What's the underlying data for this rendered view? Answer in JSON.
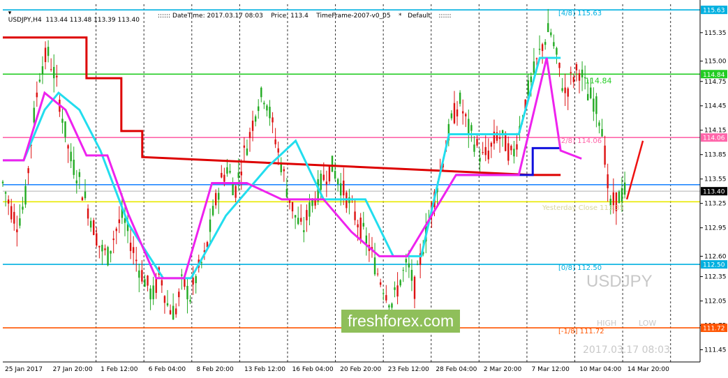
{
  "header": {
    "symbol_line": "USDJPY,H4  113.44 113.48 113.39 113.40",
    "info_line": ":::::: DateTime: 2017.03.17 08:03    Price: 113.4    TimeFrame-2007-v0_05    *   Default    ::::::"
  },
  "watermark": "freshforex.com",
  "overlay": {
    "symbol": "USDJPY",
    "high_label": "HIGH",
    "low_label": "LOW",
    "datetime": "2017.03.17 08:03",
    "yesterday_close": "Yesterday Close 113.35"
  },
  "chart_data": {
    "type": "candlestick",
    "ylim": [
      111.3,
      115.7
    ],
    "x_ticks": [
      "25 Jan 2017",
      "27 Jan 20:00",
      "1 Feb 12:00",
      "6 Feb 04:00",
      "8 Feb 20:00",
      "13 Feb 12:00",
      "16 Feb 04:00",
      "20 Feb 20:00",
      "23 Feb 12:00",
      "28 Feb 04:00",
      "2 Mar 20:00",
      "7 Mar 12:00",
      "10 Mar 04:00",
      "14 Mar 20:00"
    ],
    "y_ticks": [
      "115.35",
      "115.00",
      "114.75",
      "114.45",
      "114.15",
      "113.85",
      "113.55",
      "113.25",
      "112.95",
      "112.60",
      "112.35",
      "112.05",
      "111.75",
      "111.45"
    ],
    "murrey_levels": [
      {
        "label": "[4/8]",
        "value": 115.63,
        "price": "115.63",
        "color": "#00b0e0"
      },
      {
        "label": "",
        "value": 114.84,
        "price": "114.84",
        "color": "#22cc22"
      },
      {
        "label": "[2/8]",
        "value": 114.06,
        "price": "114.06",
        "color": "#ff66aa"
      },
      {
        "label": "",
        "value": 113.48,
        "price": "",
        "color": "#2288ff"
      },
      {
        "label": "",
        "value": 113.27,
        "price": "",
        "color": "#e8e800"
      },
      {
        "label": "[0/8]",
        "value": 112.5,
        "price": "112.50",
        "color": "#00b0e0"
      },
      {
        "label": "[-1/8]",
        "value": 111.72,
        "price": "111.72",
        "color": "#ff5500"
      }
    ],
    "current_price": {
      "value": 113.4,
      "price": "113.40"
    },
    "level_texts": {
      "green": "114.84",
      "pink": "114.06",
      "blue": "112.50",
      "orange": "111.72",
      "yc": "113.35"
    },
    "ohlc_closes": [
      113.5,
      113.2,
      113.0,
      113.3,
      114.2,
      114.9,
      115.1,
      114.8,
      114.3,
      113.8,
      113.6,
      113.3,
      113.0,
      112.7,
      112.6,
      112.9,
      113.1,
      112.8,
      112.5,
      112.3,
      112.1,
      112.4,
      112.0,
      111.9,
      112.3,
      112.1,
      112.4,
      112.6,
      113.1,
      113.5,
      113.7,
      113.4,
      113.8,
      114.1,
      114.5,
      114.6,
      114.2,
      113.8,
      113.4,
      113.1,
      112.9,
      113.2,
      113.4,
      113.6,
      113.7,
      113.5,
      113.3,
      113.1,
      112.9,
      112.7,
      112.4,
      112.2,
      112.0,
      112.3,
      112.5,
      112.2,
      112.7,
      113.1,
      113.5,
      113.9,
      114.3,
      114.5,
      114.2,
      114.0,
      113.8,
      113.9,
      114.1,
      114.0,
      113.8,
      114.2,
      114.6,
      114.9,
      115.2,
      115.4,
      115.0,
      114.6,
      114.8,
      114.9,
      114.6,
      114.5,
      114.2,
      113.2,
      113.3,
      113.4
    ],
    "trend_red": {
      "x": [
        0,
        0.12,
        0.12,
        0.15,
        0.15,
        0.17,
        0.17,
        0.2,
        0.2,
        0.76,
        0.76,
        0.8
      ],
      "y": [
        115.29,
        115.29,
        114.79,
        114.79,
        114.79,
        114.79,
        114.14,
        114.14,
        113.82,
        113.6,
        113.6,
        113.6
      ]
    },
    "trend_blue": {
      "x": [
        0.65,
        0.76,
        0.76,
        0.8
      ],
      "y": [
        113.6,
        113.6,
        113.93,
        113.93
      ]
    },
    "trend_cyan": {
      "x": [
        0,
        0.03,
        0.06,
        0.08,
        0.11,
        0.14,
        0.18,
        0.23,
        0.27,
        0.32,
        0.38,
        0.42,
        0.46,
        0.52,
        0.56,
        0.6,
        0.64,
        0.7,
        0.74,
        0.77,
        0.8
      ],
      "y": [
        113.78,
        113.78,
        114.4,
        114.61,
        114.4,
        113.9,
        113.0,
        112.33,
        112.33,
        113.1,
        113.7,
        114.02,
        113.3,
        113.3,
        112.6,
        112.6,
        114.1,
        114.1,
        114.1,
        115.04,
        115.04
      ]
    },
    "trend_magenta": {
      "x": [
        0,
        0.03,
        0.06,
        0.09,
        0.12,
        0.15,
        0.18,
        0.22,
        0.26,
        0.3,
        0.35,
        0.4,
        0.46,
        0.5,
        0.54,
        0.58,
        0.65,
        0.7,
        0.74,
        0.78,
        0.8,
        0.83
      ],
      "y": [
        113.78,
        113.78,
        114.61,
        114.4,
        113.84,
        113.84,
        113.12,
        112.33,
        112.33,
        113.5,
        113.5,
        113.3,
        113.3,
        112.9,
        112.6,
        112.6,
        113.6,
        113.6,
        113.6,
        115.04,
        113.9,
        113.8
      ]
    },
    "candles": {
      "count": 220
    }
  }
}
